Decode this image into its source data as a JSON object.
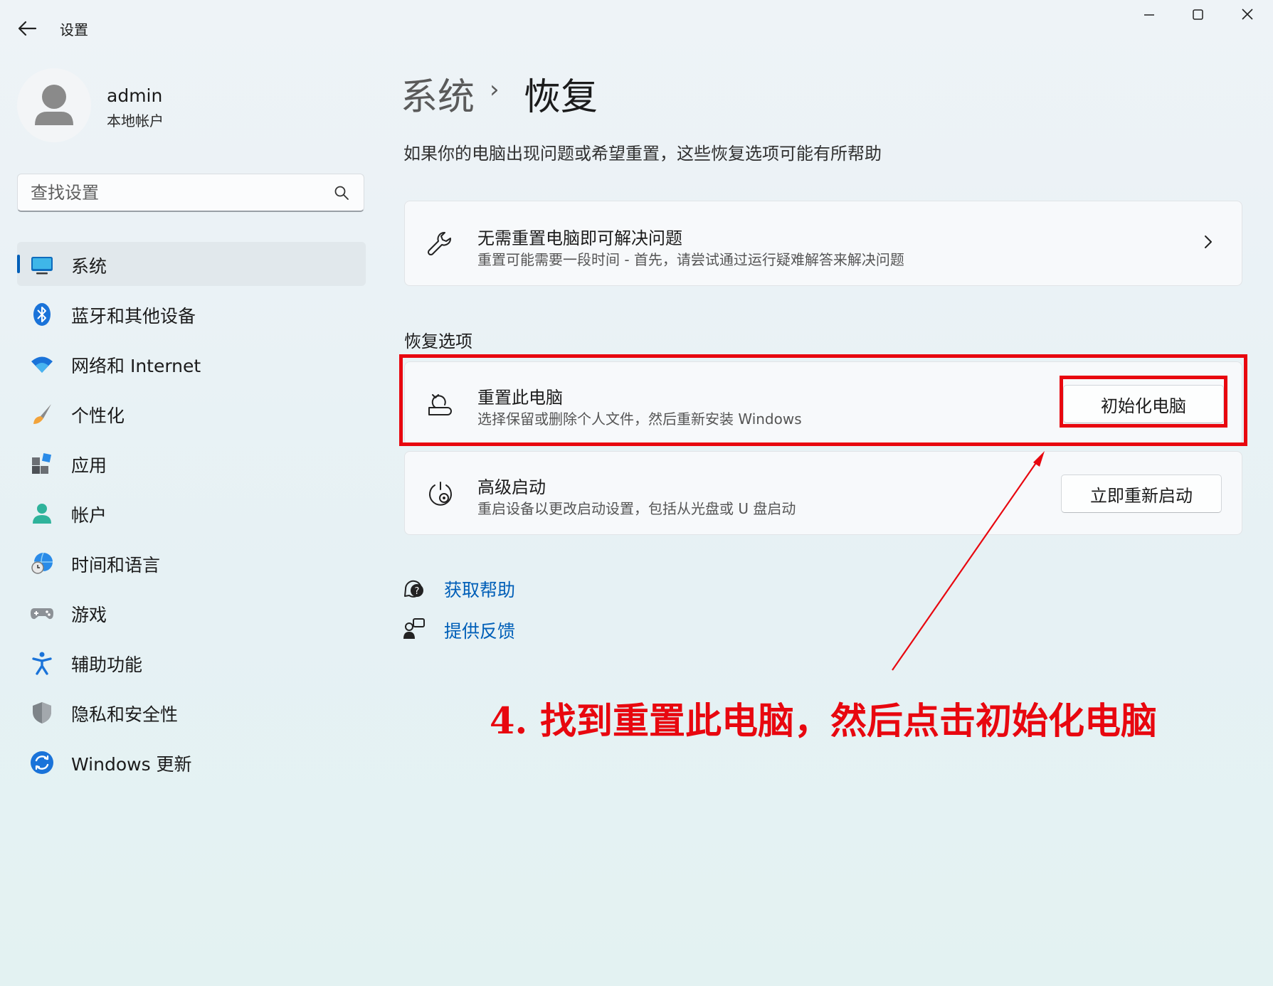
{
  "titlebar": {
    "title": "设置",
    "back_icon": "arrow-left-icon",
    "controls": [
      "minimize-icon",
      "maximize-icon",
      "close-icon"
    ]
  },
  "account": {
    "name": "admin",
    "type": "本地帐户"
  },
  "search": {
    "placeholder": "查找设置"
  },
  "nav": {
    "selected_index": 0,
    "items": [
      {
        "label": "系统",
        "icon": "system-display-icon"
      },
      {
        "label": "蓝牙和其他设备",
        "icon": "bluetooth-icon"
      },
      {
        "label": "网络和 Internet",
        "icon": "wifi-icon"
      },
      {
        "label": "个性化",
        "icon": "brush-icon"
      },
      {
        "label": "应用",
        "icon": "apps-icon"
      },
      {
        "label": "帐户",
        "icon": "account-icon"
      },
      {
        "label": "时间和语言",
        "icon": "globe-clock-icon"
      },
      {
        "label": "游戏",
        "icon": "gamepad-icon"
      },
      {
        "label": "辅助功能",
        "icon": "accessibility-icon"
      },
      {
        "label": "隐私和安全性",
        "icon": "shield-icon"
      },
      {
        "label": "Windows 更新",
        "icon": "update-icon"
      }
    ]
  },
  "page": {
    "breadcrumb_parent": "系统",
    "breadcrumb_separator": "›",
    "breadcrumb_current": "恢复",
    "description": "如果你的电脑出现问题或希望重置，这些恢复选项可能有所帮助"
  },
  "troubleshoot": {
    "title": "无需重置电脑即可解决问题",
    "subtitle": "重置可能需要一段时间 - 首先，请尝试通过运行疑难解答来解决问题"
  },
  "recovery_section": {
    "heading": "恢复选项",
    "reset": {
      "title": "重置此电脑",
      "subtitle": "选择保留或删除个人文件，然后重新安装 Windows",
      "button": "初始化电脑"
    },
    "advanced": {
      "title": "高级启动",
      "subtitle": "重启设备以更改启动设置，包括从光盘或 U 盘启动",
      "button": "立即重新启动"
    }
  },
  "help_links": {
    "get_help": "获取帮助",
    "feedback": "提供反馈"
  },
  "annotation": {
    "instruction": "4. 找到重置此电脑，然后点击初始化电脑",
    "color": "#e8070f"
  },
  "colors": {
    "accent": "#005fb8"
  }
}
